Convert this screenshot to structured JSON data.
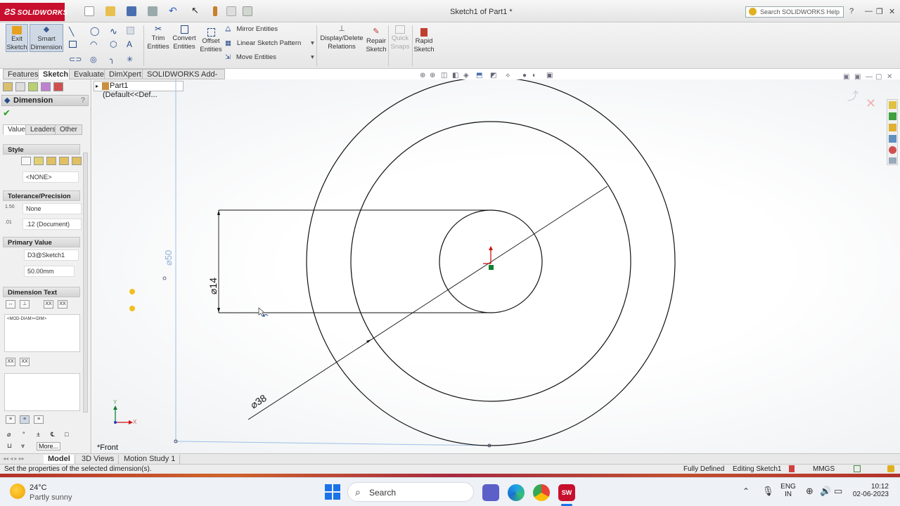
{
  "app": {
    "brand": "SOLIDWORKS",
    "doc_title": "Sketch1 of Part1 *",
    "help_search_placeholder": "Search SOLIDWORKS Help"
  },
  "command_manager": {
    "exit_sketch": [
      "Exit",
      "Sketch"
    ],
    "smart_dimension": [
      "Smart",
      "Dimension"
    ],
    "trim": [
      "Trim",
      "Entities"
    ],
    "convert": [
      "Convert",
      "Entities"
    ],
    "offset": [
      "Offset",
      "Entities"
    ],
    "mirror": "Mirror Entities",
    "linear_pattern": "Linear Sketch Pattern",
    "move": "Move Entities",
    "display_delete": [
      "Display/Delete",
      "Relations"
    ],
    "repair": [
      "Repair",
      "Sketch"
    ],
    "quick_snaps": [
      "Quick",
      "Snaps"
    ],
    "rapid": [
      "Rapid",
      "Sketch"
    ]
  },
  "tabs": [
    "Features",
    "Sketch",
    "Evaluate",
    "DimXpert",
    "SOLIDWORKS Add-Ins"
  ],
  "feature_tree": {
    "part": "Part1  (Default<<Def..."
  },
  "property_manager": {
    "title": "Dimension",
    "subtabs": [
      "Value",
      "Leaders",
      "Other"
    ],
    "style": {
      "header": "Style",
      "value": "<NONE>"
    },
    "tolerance": {
      "header": "Tolerance/Precision",
      "tol_type": "None",
      "precision": ".12 (Document)"
    },
    "primary": {
      "header": "Primary Value",
      "name": "D3@Sketch1",
      "value": "50.00mm"
    },
    "dimtext": {
      "header": "Dimension Text",
      "text": "<MOD-DIAM><DIM>",
      "more": "More..."
    }
  },
  "sketch": {
    "dim_50": "⌀50",
    "dim_14": "⌀14",
    "dim_38": "⌀38",
    "view_label": "*Front"
  },
  "bottom_tabs": [
    "Model",
    "3D Views",
    "Motion Study 1"
  ],
  "status": {
    "message": "Set the properties of the selected dimension(s).",
    "state": "Fully Defined",
    "editing": "Editing Sketch1",
    "units": "MMGS"
  },
  "taskbar": {
    "temp": "24°C",
    "weather": "Partly sunny",
    "search": "Search",
    "lang1": "ENG",
    "lang2": "IN",
    "time": "10:12",
    "date": "02-06-2023"
  },
  "colors": {
    "accent": "#c8102e",
    "sketch_line": "#111111",
    "dim_blue": "#7aa0d0",
    "origin_red": "#d01010",
    "origin_green": "#108030"
  }
}
